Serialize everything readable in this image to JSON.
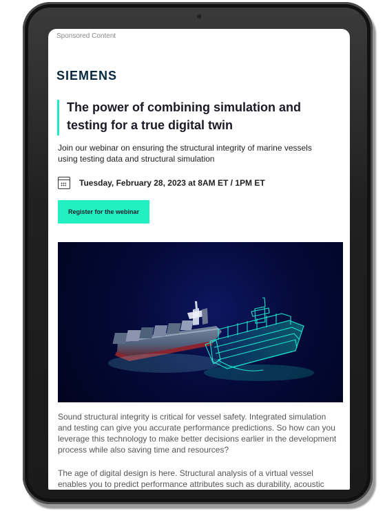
{
  "ad": {
    "label": "Sponsored Content",
    "brand": "SIEMENS",
    "headline": "The power of combining simulation and testing for a true digital twin",
    "subheadline": "Join our webinar on ensuring the structural integrity of marine vessels using testing data and structural simulation",
    "date": "Tuesday, February 28, 2023 at 8AM ET / 1PM ET",
    "cta": "Register for the webinar",
    "paragraphs": [
      "Sound structural integrity is critical for vessel safety. Integrated simulation and testing can give you accurate performance predictions. So how can you leverage this technology to make better decisions earlier in the development process while also saving time and resources?",
      "The age of digital design is here. Structural analysis of a virtual vessel enables you to predict performance attributes such as durability, acoustic performance and"
    ]
  },
  "icons": {
    "calendar": "calendar-icon"
  },
  "colors": {
    "accent": "#22f0c2",
    "brand": "#05283f",
    "hero_background": "#040a39"
  }
}
